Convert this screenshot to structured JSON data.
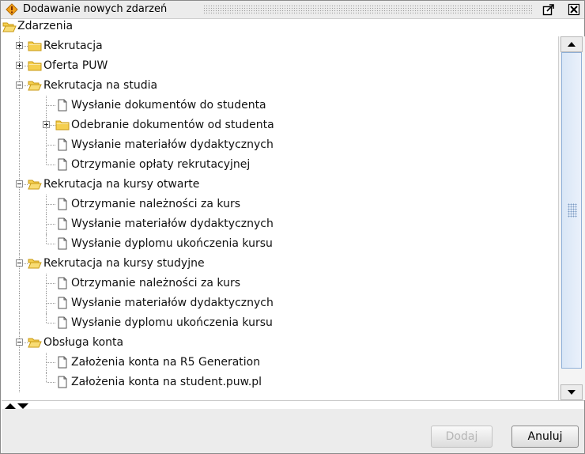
{
  "window": {
    "title": "Dodawanie nowych zdarzeń",
    "title_icon": "diamond-warning-icon",
    "maximize_icon": "maximize-icon",
    "close_icon": "close-icon"
  },
  "tree": {
    "root": {
      "label": "Zdarzenia",
      "icon": "folder-open-icon",
      "expanded": true
    },
    "rows": [
      {
        "label": "Rekrutacja",
        "type": "folder",
        "level": 1,
        "expanded": false
      },
      {
        "label": "Oferta PUW",
        "type": "folder",
        "level": 1,
        "expanded": false
      },
      {
        "label": "Rekrutacja na studia",
        "type": "folder",
        "level": 1,
        "expanded": true
      },
      {
        "label": "Wysłanie dokumentów do studenta",
        "type": "leaf",
        "level": 2
      },
      {
        "label": "Odebranie dokumentów od studenta",
        "type": "folder",
        "level": 2,
        "expanded": false
      },
      {
        "label": "Wysłanie materiałów dydaktycznych",
        "type": "leaf",
        "level": 2
      },
      {
        "label": "Otrzymanie opłaty rekrutacyjnej",
        "type": "leaf",
        "level": 2
      },
      {
        "label": "Rekrutacja na kursy otwarte",
        "type": "folder",
        "level": 1,
        "expanded": true
      },
      {
        "label": "Otrzymanie należności za kurs",
        "type": "leaf",
        "level": 2
      },
      {
        "label": "Wysłanie materiałów dydaktycznych",
        "type": "leaf",
        "level": 2
      },
      {
        "label": "Wysłanie dyplomu ukończenia kursu",
        "type": "leaf",
        "level": 2
      },
      {
        "label": "Rekrutacja na kursy studyjne",
        "type": "folder",
        "level": 1,
        "expanded": true
      },
      {
        "label": "Otrzymanie należności za kurs",
        "type": "leaf",
        "level": 2
      },
      {
        "label": "Wysłanie materiałów dydaktycznych",
        "type": "leaf",
        "level": 2
      },
      {
        "label": "Wysłanie dyplomu ukończenia kursu",
        "type": "leaf",
        "level": 2
      },
      {
        "label": "Obsługa konta",
        "type": "folder",
        "level": 1,
        "expanded": true
      },
      {
        "label": "Założenia konta na R5 Generation",
        "type": "leaf",
        "level": 2
      },
      {
        "label": "Założenia konta na student.puw.pl",
        "type": "leaf",
        "level": 2
      }
    ]
  },
  "scrollbar": {
    "up_icon": "arrow-up-icon",
    "down_icon": "arrow-down-icon",
    "position_fraction": 0.0
  },
  "splitter": {
    "up_icon": "split-up-icon",
    "down_icon": "split-down-icon"
  },
  "buttons": {
    "add_label": "Dodaj",
    "add_enabled": false,
    "cancel_label": "Anuluj"
  },
  "colors": {
    "folder": "#f5cf4f",
    "folder_dark": "#c89a14",
    "scroll_thumb": "#d9e6f6",
    "title_icon": "#f2a21b"
  }
}
